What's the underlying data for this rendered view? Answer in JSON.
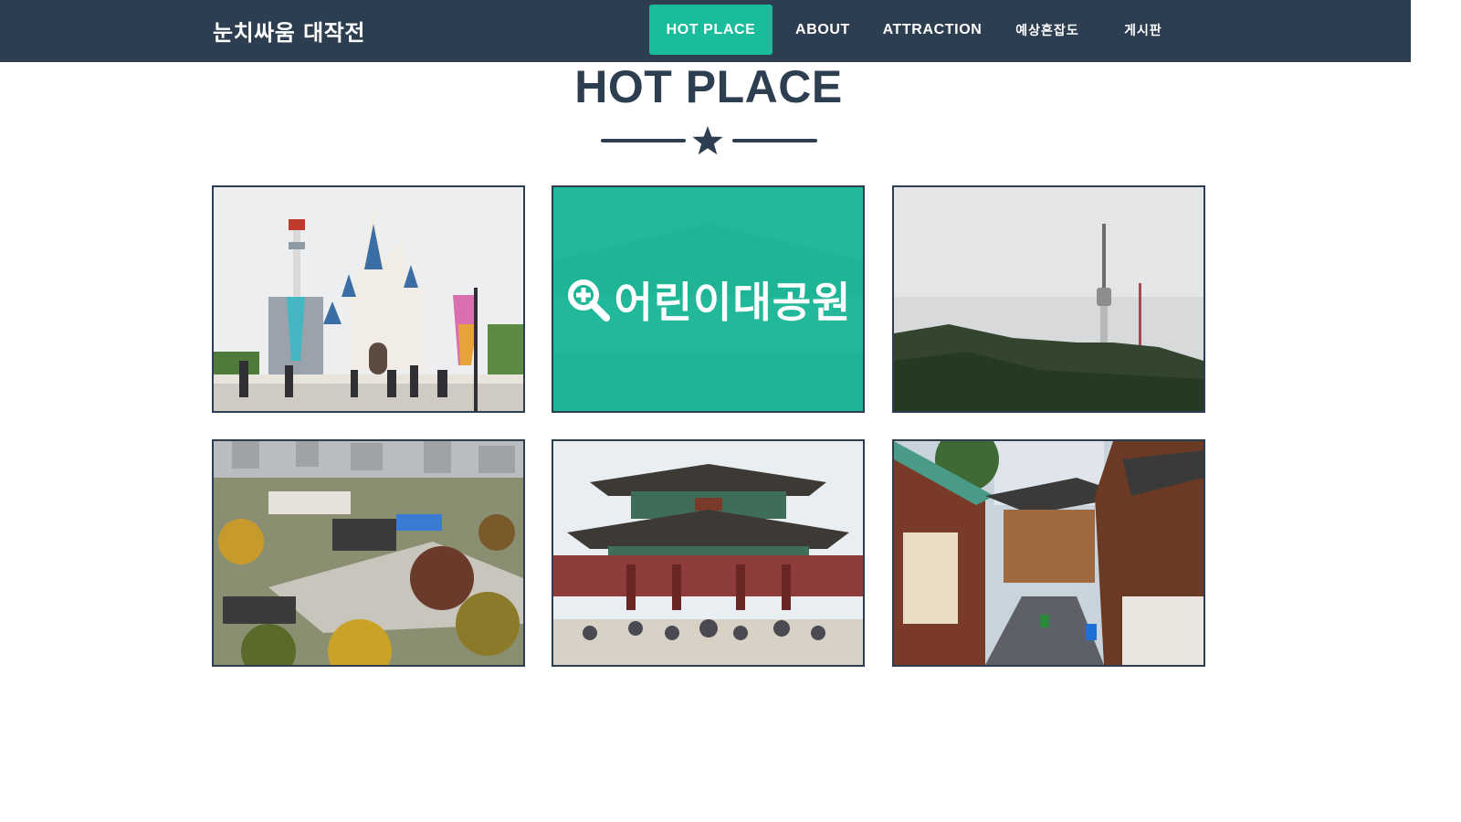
{
  "navbar": {
    "brand": "눈치싸움 대작전",
    "items": [
      {
        "label": "HOT PLACE",
        "active": true
      },
      {
        "label": "ABOUT",
        "active": false
      },
      {
        "label": "ATTRACTION",
        "active": false
      },
      {
        "label": "예상혼잡도",
        "active": false
      },
      {
        "label": "게시판",
        "active": false
      }
    ]
  },
  "section": {
    "title": "HOT PLACE",
    "divider_icon": "star-icon"
  },
  "gallery": {
    "hovered_label": "어린이대공원",
    "hover_icon": "zoom-in-icon",
    "tiles": [
      {
        "subject": "castle-theme-park-photo"
      },
      {
        "subject": "hovered-tile"
      },
      {
        "subject": "mountain-tower-photo"
      },
      {
        "subject": "palace-aerial-photo"
      },
      {
        "subject": "palace-gate-photo"
      },
      {
        "subject": "hanok-alley-photo"
      }
    ]
  },
  "colors": {
    "primary": "#2c3e50",
    "accent": "#1abc9c",
    "background": "#ffffff"
  }
}
